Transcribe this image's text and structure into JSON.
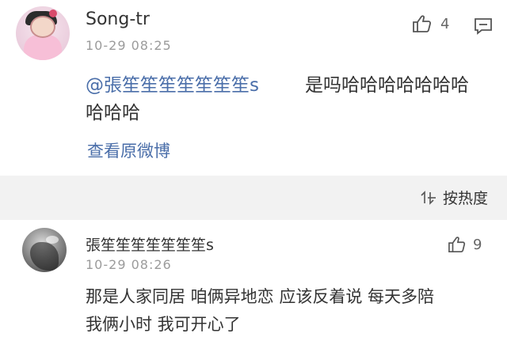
{
  "comments": [
    {
      "username": "Song-tr",
      "time": "10-29 08:25",
      "likes": "4",
      "mention": "@張笙笙笙笙笙笙笙s",
      "text_line1": "是吗哈哈哈哈哈哈哈",
      "text_line2": "哈哈哈",
      "view_original": "查看原微博",
      "avatar": "cartoon-girl-avatar"
    }
  ],
  "sort_label": "按热度",
  "reply": {
    "username": "張笙笙笙笙笙笙笙s",
    "time": "10-29 08:26",
    "likes": "9",
    "text_line1": "那是人家同居 咱俩异地恋 应该反着说 每天多陪",
    "text_line2": "我俩小时 我可开心了",
    "avatar": "dark-photo-avatar"
  },
  "colors": {
    "link_blue": "#4a6ea9",
    "text": "#333333",
    "muted": "#9b9b9b",
    "band": "#f2f2f2"
  },
  "icons": [
    "thumbs-up-icon",
    "comment-icon",
    "sort-icon"
  ]
}
